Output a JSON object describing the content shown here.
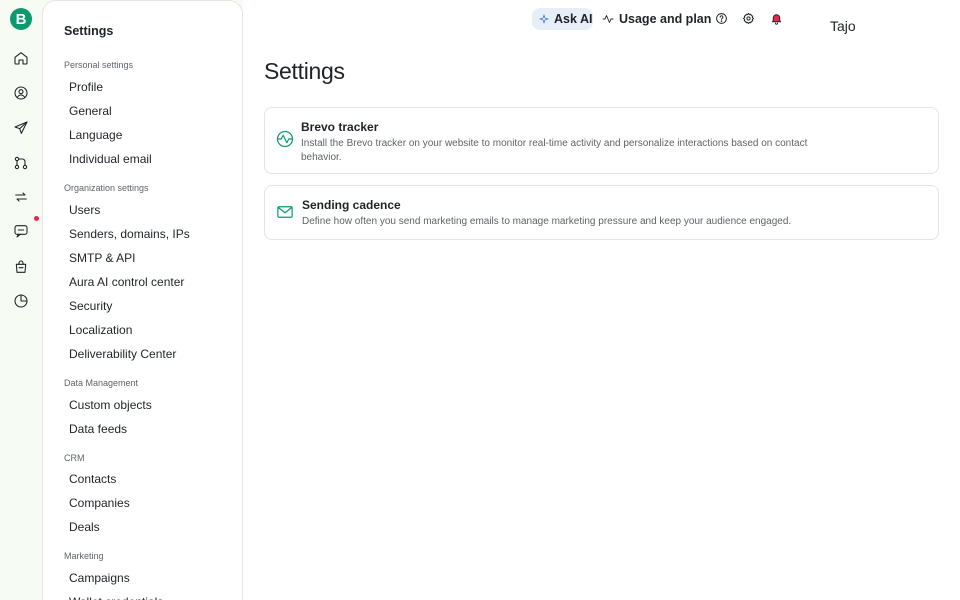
{
  "app": {
    "logo_letter": "B"
  },
  "rail": {
    "items": [
      {
        "name": "home-icon"
      },
      {
        "name": "contacts-icon"
      },
      {
        "name": "campaigns-icon"
      },
      {
        "name": "automations-icon"
      },
      {
        "name": "transactional-icon"
      },
      {
        "name": "conversations-icon"
      },
      {
        "name": "sales-icon"
      },
      {
        "name": "reports-icon"
      }
    ]
  },
  "sidebar": {
    "title": "Settings",
    "sections": [
      {
        "label": "Personal settings",
        "items": [
          "Profile",
          "General",
          "Language",
          "Individual email"
        ]
      },
      {
        "label": "Organization settings",
        "items": [
          "Users",
          "Senders, domains, IPs",
          "SMTP & API",
          "Aura AI control center",
          "Security",
          "Localization",
          "Deliverability Center"
        ]
      },
      {
        "label": "Data Management",
        "items": [
          "Custom objects",
          "Data feeds"
        ]
      },
      {
        "label": "CRM",
        "items": [
          "Contacts",
          "Companies",
          "Deals"
        ]
      },
      {
        "label": "Marketing",
        "items": [
          "Campaigns",
          "Wallet credentials"
        ]
      }
    ]
  },
  "topbar": {
    "ask_ai": "Ask AI",
    "usage": "Usage and plan",
    "user_name": "Tajo"
  },
  "main": {
    "title": "Settings",
    "cards": [
      {
        "title": "Brevo tracker",
        "description": "Install the Brevo tracker on your website to monitor real-time activity and personalize interactions based on contact behavior.",
        "icon": "activity-icon"
      },
      {
        "title": "Sending cadence",
        "description": "Define how often you send marketing emails to manage marketing pressure and keep your audience engaged.",
        "icon": "envelope-icon"
      }
    ]
  },
  "colors": {
    "brand": "#0b996e",
    "notification": "#e8274b",
    "ask_ai_bg": "#e7eef8"
  }
}
